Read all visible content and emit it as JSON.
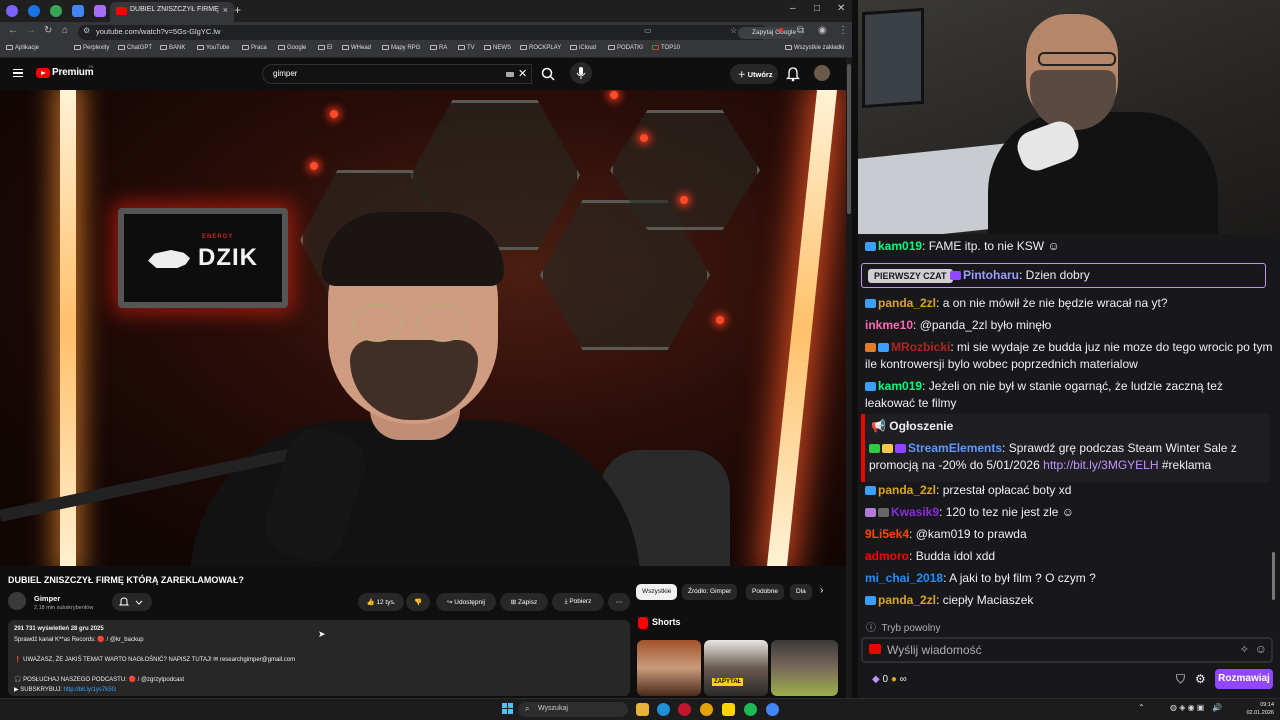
{
  "browser": {
    "active_tab_title": "DUBIEL ZNISZCZYŁ FIRMĘ KTÓRĄ ZAREKLAMOWAŁ? - YouTube",
    "url": "youtube.com/watch?v=5Gs-GlgYC.lw",
    "google_chip": "Zapytaj Google",
    "bookmarks": [
      "Aplikacje",
      "Perplexity",
      "ChatGPT",
      "BANK",
      "YouTube",
      "Praca",
      "Google",
      "El",
      "WHead",
      "Mapy RPG",
      "RA",
      "TV",
      "NEWS",
      "ROCKPLAY",
      "iCloud",
      "PODATKI",
      "TOP10"
    ],
    "all_bookmarks": "Wszystkie zakładki"
  },
  "youtube": {
    "brand": "Premium",
    "country": "PL",
    "search_value": "gimper",
    "create_label": "Utwórz",
    "video": {
      "sign_small": "ENERGY",
      "sign_text": "DZIK"
    },
    "title": "DUBIEL ZNISZCZYŁ FIRMĘ KTÓRĄ ZAREKLAMOWAŁ?",
    "channel": {
      "name": "Gimper",
      "subscribers": "2,18 mln subskrybentów"
    },
    "actions": {
      "likes": "12 tys.",
      "share": "Udostępnij",
      "save": "Zapisz",
      "download": "Pobierz"
    },
    "description": {
      "stats": "291 731 wyświetleń  28 gru 2025",
      "line1": "Sprawdź kanał K**as Records: 🔴 / @kr_backup",
      "line2": "❗ UWAŻASZ, ŻE JAKIŚ TEMAT WARTO NAGŁOŚNIĆ? NAPISZ TUTAJ! ✉ researchgimper@gmail.com",
      "line3": "🎧 POSŁUCHAJ NASZEGO PODCASTU: 🔴 / @zgrzytpodcast",
      "line4_label": "▶ SUBSKRYBUJ:",
      "line4_link": "http://bit.ly/1ys7k5G"
    },
    "chips": [
      "Wszystkie",
      "Źródło: Gimper",
      "Podobne",
      "Dla"
    ],
    "shorts_label": "Shorts",
    "shorts_overlay": "ZAPYTAŁ"
  },
  "chat": {
    "messages": [
      {
        "user": "kam019",
        "color": "#00ff7f",
        "text": "FAME itp. to nie KSW"
      },
      {
        "user": "Pintoharu",
        "color": "#9d9dff",
        "text": "Dzien dobry",
        "first": true
      },
      {
        "user": "panda_2zl",
        "color": "#daa520",
        "text": "a on nie mówił że nie będzie wracał na yt?"
      },
      {
        "user": "inkme10",
        "color": "#ff69b4",
        "text": "@panda_2zl było minęło"
      },
      {
        "user": "MRozbicki",
        "color": "#b22222",
        "text": "mi sie wydaje ze budda juz nie moze do tego wrocic po tym ile kontrowersji bylo wobec poprzednich materialow"
      },
      {
        "user": "kam019",
        "color": "#00ff7f",
        "text": "Jeżeli on nie był w stanie ogarnąć, że ludzie zaczną też leakować te filmy"
      },
      {
        "user": "StreamElements",
        "color": "#5b99ff",
        "text": "Sprawdź grę podczas Steam Winter Sale z promocją na -20% do 5/01/2026",
        "link": "http://bit.ly/3MGYELH",
        "tag": "#reklama"
      },
      {
        "user": "panda_2zl",
        "color": "#daa520",
        "text": "przestał opłacać boty xd"
      },
      {
        "user": "Kwasik9",
        "color": "#8a2be2",
        "text": "120 to tez nie jest zle"
      },
      {
        "user": "9Li5ek4",
        "color": "#ff4500",
        "text": "@kam019 to prawda"
      },
      {
        "user": "admoro",
        "color": "#ff0000",
        "text": "Budda idol xdd"
      },
      {
        "user": "mi_chai_2018",
        "color": "#1e90ff",
        "text": "A jaki to był film ? O czym ?"
      },
      {
        "user": "panda_2zl",
        "color": "#daa520",
        "text": "ciepły Maciaszek"
      }
    ],
    "first_chat_badge": "PIERWSZY CZAT",
    "announcement_label": "Ogłoszenie",
    "slow_mode": "Tryb powolny",
    "input_placeholder": "Wyślij wiadomość",
    "points": "0",
    "chat_button": "Rozmawiaj"
  },
  "taskbar": {
    "search_placeholder": "Wyszukaj",
    "time": "09:14",
    "date": "02.01.2026"
  }
}
